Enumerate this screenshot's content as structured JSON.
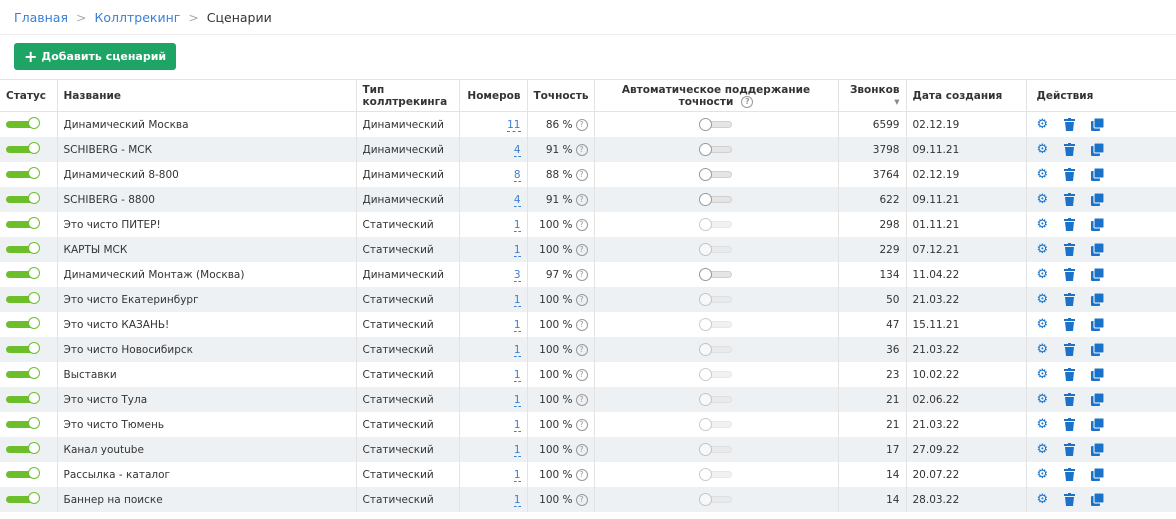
{
  "breadcrumb": [
    "Главная",
    "Коллтрекинг",
    "Сценарии"
  ],
  "add_button": "Добавить сценарий",
  "columns": {
    "status": "Статус",
    "name": "Название",
    "type": "Тип коллтрекинга",
    "numbers": "Номеров",
    "accuracy": "Точность",
    "auto": "Автоматическое поддержание точности",
    "calls": "Звонков",
    "calls_sort": "▾",
    "date": "Дата создания",
    "actions": "Действия"
  },
  "rows": [
    {
      "name": "Динамический Москва",
      "type": "Динамический",
      "numbers": "11",
      "accuracy": "86 %",
      "calls": "6599",
      "date": "02.12.19",
      "dynamic": true
    },
    {
      "name": "SCHIBERG - МСК",
      "type": "Динамический",
      "numbers": "4",
      "accuracy": "91 %",
      "calls": "3798",
      "date": "09.11.21",
      "dynamic": true
    },
    {
      "name": "Динамический 8-800",
      "type": "Динамический",
      "numbers": "8",
      "accuracy": "88 %",
      "calls": "3764",
      "date": "02.12.19",
      "dynamic": true
    },
    {
      "name": "SCHIBERG - 8800",
      "type": "Динамический",
      "numbers": "4",
      "accuracy": "91 %",
      "calls": "622",
      "date": "09.11.21",
      "dynamic": true
    },
    {
      "name": "Это чисто ПИТЕР!",
      "type": "Статический",
      "numbers": "1",
      "accuracy": "100 %",
      "calls": "298",
      "date": "01.11.21",
      "dynamic": false
    },
    {
      "name": "КАРТЫ МСК",
      "type": "Статический",
      "numbers": "1",
      "accuracy": "100 %",
      "calls": "229",
      "date": "07.12.21",
      "dynamic": false
    },
    {
      "name": "Динамический Монтаж (Москва)",
      "type": "Динамический",
      "numbers": "3",
      "accuracy": "97 %",
      "calls": "134",
      "date": "11.04.22",
      "dynamic": true
    },
    {
      "name": "Это чисто Екатеринбург",
      "type": "Статический",
      "numbers": "1",
      "accuracy": "100 %",
      "calls": "50",
      "date": "21.03.22",
      "dynamic": false
    },
    {
      "name": "Это чисто КАЗАНЬ!",
      "type": "Статический",
      "numbers": "1",
      "accuracy": "100 %",
      "calls": "47",
      "date": "15.11.21",
      "dynamic": false
    },
    {
      "name": "Это чисто Новосибирск",
      "type": "Статический",
      "numbers": "1",
      "accuracy": "100 %",
      "calls": "36",
      "date": "21.03.22",
      "dynamic": false
    },
    {
      "name": "Выставки",
      "type": "Статический",
      "numbers": "1",
      "accuracy": "100 %",
      "calls": "23",
      "date": "10.02.22",
      "dynamic": false
    },
    {
      "name": "Это чисто Тула",
      "type": "Статический",
      "numbers": "1",
      "accuracy": "100 %",
      "calls": "21",
      "date": "02.06.22",
      "dynamic": false
    },
    {
      "name": "Это чисто Тюмень",
      "type": "Статический",
      "numbers": "1",
      "accuracy": "100 %",
      "calls": "21",
      "date": "21.03.22",
      "dynamic": false
    },
    {
      "name": "Канал youtube",
      "type": "Статический",
      "numbers": "1",
      "accuracy": "100 %",
      "calls": "17",
      "date": "27.09.22",
      "dynamic": false
    },
    {
      "name": "Рассылка - каталог",
      "type": "Статический",
      "numbers": "1",
      "accuracy": "100 %",
      "calls": "14",
      "date": "20.07.22",
      "dynamic": false
    },
    {
      "name": "Баннер на поиске",
      "type": "Статический",
      "numbers": "1",
      "accuracy": "100 %",
      "calls": "14",
      "date": "28.03.22",
      "dynamic": false
    }
  ]
}
